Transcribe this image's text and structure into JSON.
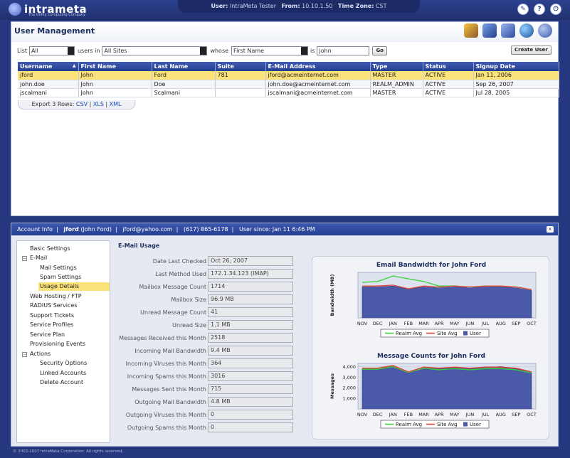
{
  "app": {
    "logo_text": "intrameta",
    "tagline": "The Utility Computing Company"
  },
  "session": {
    "user_label": "User:",
    "user": "IntraMeta Tester",
    "from_label": "From:",
    "from": "10.10.1.50",
    "tz_label": "Time Zone:",
    "tz": "CST"
  },
  "top_icons": {
    "tools": "tools-icon",
    "help": "help-icon",
    "power": "power-icon"
  },
  "page": {
    "title": "User Management"
  },
  "filter": {
    "list_label": "List",
    "list_value": "All",
    "users_in_label": "users in",
    "site_value": "All Sites",
    "whose_label": "whose",
    "field_value": "First Name",
    "is_label": "is",
    "search_value": "john",
    "go_label": "Go",
    "create_label": "Create User"
  },
  "table": {
    "headers": [
      "Username",
      "First Name",
      "Last Name",
      "Suite",
      "E-Mail Address",
      "Type",
      "Status",
      "Signup Date"
    ],
    "rows": [
      [
        "jford",
        "John",
        "Ford",
        "781",
        "jford@acmeinternet.com",
        "MASTER",
        "ACTIVE",
        "Jan 11, 2006"
      ],
      [
        "john.doe",
        "John",
        "Doe",
        "",
        "john.doe@acmeinternet.com",
        "REALM_ADMIN",
        "ACTIVE",
        "Sep 26, 2007"
      ],
      [
        "jscalmani",
        "John",
        "Scalmani",
        "",
        "jscalmani@acmeinternet.com",
        "MASTER",
        "ACTIVE",
        "Jul 28, 2005"
      ]
    ],
    "export_label": "Export 3 Rows:",
    "export_csv": "CSV",
    "export_xls": "XLS",
    "export_xml": "XML"
  },
  "account": {
    "tab": "Account Info",
    "username": "jford",
    "fullname": "(John Ford)",
    "email": "jford@yahoo.com",
    "phone": "(617) 865-6178",
    "since": "User since: Jan 11 6:46 PM",
    "close_label": "x"
  },
  "tree": {
    "basic": "Basic Settings",
    "email": "E-Mail",
    "mail_settings": "Mail Settings",
    "spam_settings": "Spam Settings",
    "usage_details": "Usage Details",
    "web_hosting": "Web Hosting / FTP",
    "radius": "RADIUS Services",
    "support": "Support Tickets",
    "profiles": "Service Profiles",
    "plan": "Service Plan",
    "provisioning": "Provisioning Events",
    "actions": "Actions",
    "security": "Security Options",
    "linked": "Linked Accounts",
    "delete": "Delete Account",
    "expander_minus": "−"
  },
  "usage": {
    "title": "E-Mail Usage",
    "fields": [
      {
        "label": "Date Last Checked",
        "value": "Oct 26, 2007"
      },
      {
        "label": "Last Method Used",
        "value": "172.1.34.123 (IMAP)"
      },
      {
        "label": "Mailbox Message Count",
        "value": "1714"
      },
      {
        "label": "Mailbox Size",
        "value": "96.9 MB"
      },
      {
        "label": "Unread Message Count",
        "value": "41"
      },
      {
        "label": "Unread Size",
        "value": "1.1 MB"
      },
      {
        "label": "Messages Received this Month",
        "value": "2518"
      },
      {
        "label": "Incoming Mail Bandwidth",
        "value": "9.4 MB"
      },
      {
        "label": "Incoming Viruses this Month",
        "value": "364"
      },
      {
        "label": "Incoming Spams this Month",
        "value": "3016"
      },
      {
        "label": "Messages Sent this Month",
        "value": "715"
      },
      {
        "label": "Outgoing Mail Bandwidth",
        "value": "4.8 MB"
      },
      {
        "label": "Outgoing Viruses this Month",
        "value": "0"
      },
      {
        "label": "Outgoing Spams this Month",
        "value": "0"
      }
    ]
  },
  "chart_data": [
    {
      "type": "area",
      "title": "Email Bandwidth for John Ford",
      "ylabel": "Bandwidth (MB)",
      "categories": [
        "NOV",
        "DEC",
        "JAN",
        "FEB",
        "MAR",
        "APR",
        "MAY",
        "JUN",
        "JUL",
        "AUG",
        "SEP",
        "OCT"
      ],
      "ylim": [
        0,
        25
      ],
      "series": [
        {
          "name": "Realm Avg",
          "color": "#3ad13a",
          "values": [
            19.5,
            20,
            23,
            21.5,
            20,
            17.5,
            17.5,
            17,
            17.5,
            17.5,
            17,
            15.5
          ]
        },
        {
          "name": "Site Avg",
          "color": "#e0443a",
          "values": [
            17.5,
            17.5,
            18,
            16,
            17.5,
            17,
            17.5,
            17,
            17.5,
            17.5,
            17,
            15.5
          ]
        },
        {
          "name": "User",
          "color": "#4a5aa8",
          "values": [
            17,
            17,
            17.5,
            16,
            17,
            16.5,
            17,
            16.5,
            17,
            17,
            16.5,
            15
          ]
        }
      ],
      "legend": "bottom"
    },
    {
      "type": "area",
      "title": "Message Counts for John Ford",
      "ylabel": "Messages",
      "categories": [
        "NOV",
        "DEC",
        "JAN",
        "FEB",
        "MAR",
        "APR",
        "MAY",
        "JUN",
        "JUL",
        "AUG",
        "SEP",
        "OCT"
      ],
      "yticks": [
        "1,000",
        "2,000",
        "3,000",
        "4,000"
      ],
      "ylim": [
        0,
        4300
      ],
      "series": [
        {
          "name": "Realm Avg",
          "color": "#3ad13a",
          "values": [
            3750,
            3750,
            4000,
            3450,
            3850,
            3700,
            3800,
            3700,
            3800,
            3800,
            3700,
            3400
          ]
        },
        {
          "name": "Site Avg",
          "color": "#e0443a",
          "values": [
            3850,
            3850,
            4100,
            3500,
            3950,
            3850,
            3950,
            3850,
            3950,
            3950,
            3850,
            3500
          ]
        },
        {
          "name": "User",
          "color": "#4a5aa8",
          "values": [
            3800,
            3800,
            4050,
            3450,
            3900,
            3800,
            3900,
            3800,
            3900,
            4000,
            3800,
            3450
          ]
        }
      ],
      "legend": "bottom"
    }
  ],
  "footer": "© 2003-2007 IntraMeta Corporation.  All rights reserved."
}
